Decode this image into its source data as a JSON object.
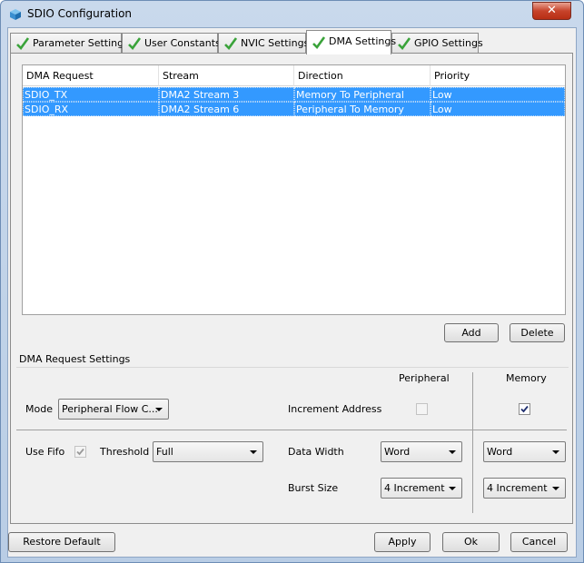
{
  "window": {
    "title": "SDIO Configuration",
    "close_glyph": "✕"
  },
  "tabs": [
    {
      "label": "Parameter Settings"
    },
    {
      "label": "User Constants"
    },
    {
      "label": "NVIC Settings"
    },
    {
      "label": "DMA Settings",
      "active": true
    },
    {
      "label": "GPIO Settings"
    }
  ],
  "dma_table": {
    "columns": [
      "DMA Request",
      "Stream",
      "Direction",
      "Priority"
    ],
    "rows": [
      {
        "request": "SDIO_TX",
        "stream": "DMA2 Stream 3",
        "direction": "Memory To Peripheral",
        "priority": "Low"
      },
      {
        "request": "SDIO_RX",
        "stream": "DMA2 Stream 6",
        "direction": "Peripheral To Memory",
        "priority": "Low"
      }
    ],
    "selection_color": "#3399ff"
  },
  "table_buttons": {
    "add": "Add",
    "delete": "Delete"
  },
  "settings": {
    "group_title": "DMA Request Settings",
    "peripheral_header": "Peripheral",
    "memory_header": "Memory",
    "mode_label": "Mode",
    "mode_value": "Peripheral Flow C...",
    "increment_label": "Increment Address",
    "increment_peripheral": false,
    "increment_memory": true,
    "use_fifo_label": "Use Fifo",
    "use_fifo": true,
    "threshold_label": "Threshold",
    "threshold_value": "Full",
    "data_width_label": "Data Width",
    "data_width_peripheral": "Word",
    "data_width_memory": "Word",
    "burst_size_label": "Burst Size",
    "burst_peripheral": "4 Increment",
    "burst_memory": "4 Increment"
  },
  "footer": {
    "restore": "Restore Default",
    "apply": "Apply",
    "ok": "Ok",
    "cancel": "Cancel"
  }
}
